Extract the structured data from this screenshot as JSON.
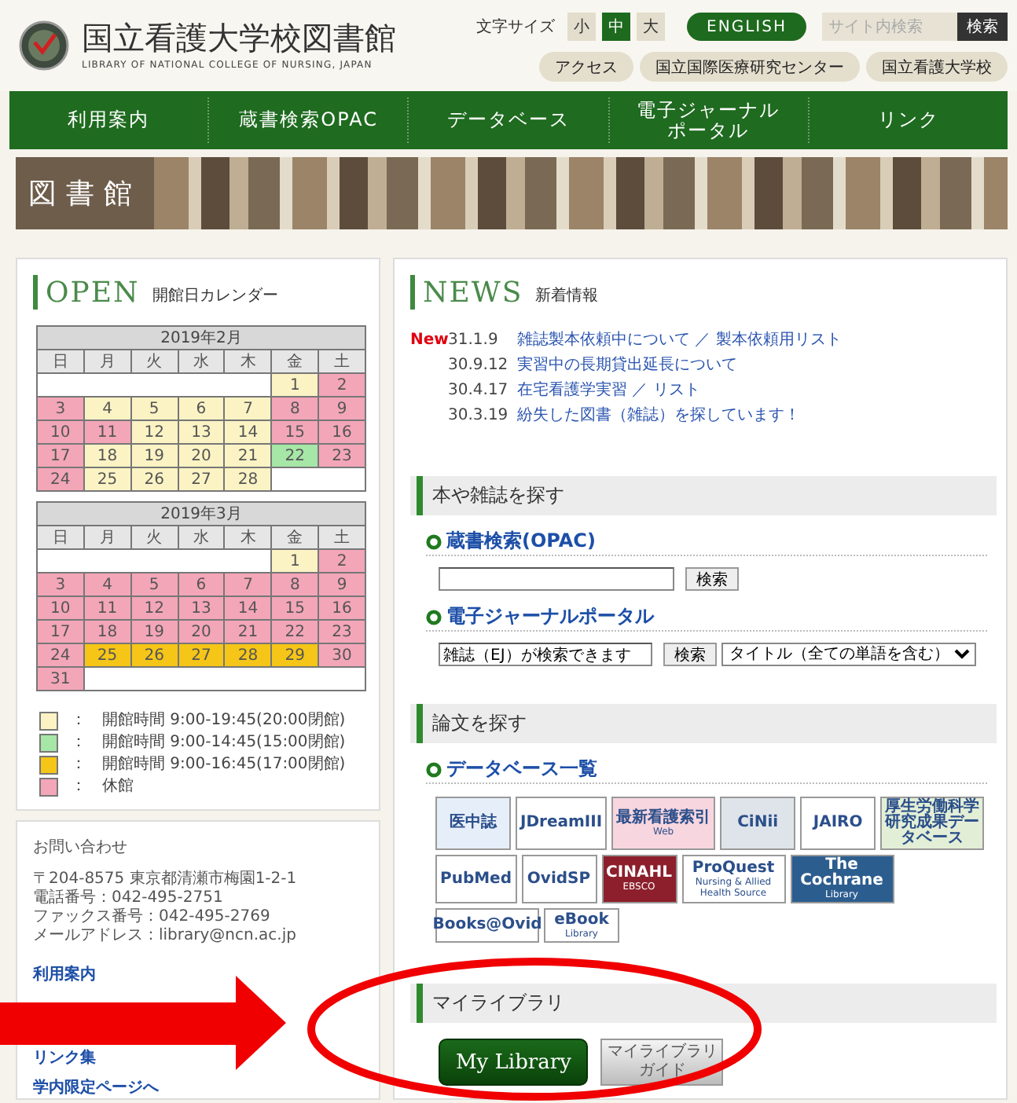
{
  "header": {
    "title": "国立看護大学校図書館",
    "subtitle": "LIBRARY OF NATIONAL COLLEGE OF NURSING, JAPAN",
    "font_size_label": "文字サイズ",
    "font_sizes": [
      {
        "label": "小",
        "selected": false
      },
      {
        "label": "中",
        "selected": true
      },
      {
        "label": "大",
        "selected": false
      }
    ],
    "english_button": "ENGLISH",
    "search": {
      "placeholder": "サイト内検索",
      "button": "検索"
    },
    "links": [
      "アクセス",
      "国立国際医療研究センター",
      "国立看護大学校"
    ]
  },
  "nav": [
    "利用案内",
    "蔵書検索OPAC",
    "データベース",
    "電子ジャーナルポータル",
    "リンク"
  ],
  "banner": {
    "label": "図書館"
  },
  "calendar_card": {
    "title": "OPEN",
    "subtitle": "開館日カレンダー",
    "months": [
      {
        "title": "2019年2月",
        "weekdays": [
          "日",
          "月",
          "火",
          "水",
          "木",
          "金",
          "土"
        ],
        "weeks": [
          [
            {
              "day": "1",
              "color": "#fbf3c4"
            },
            {
              "day": "2",
              "color": "#f3a6b8"
            }
          ],
          [
            {
              "day": "3",
              "color": "#f3a6b8"
            },
            {
              "day": "4",
              "color": "#fbf3c4"
            },
            {
              "day": "5",
              "color": "#fbf3c4"
            },
            {
              "day": "6",
              "color": "#fbf3c4"
            },
            {
              "day": "7",
              "color": "#fbf3c4"
            },
            {
              "day": "8",
              "color": "#f3a6b8"
            },
            {
              "day": "9",
              "color": "#f3a6b8"
            }
          ],
          [
            {
              "day": "10",
              "color": "#f3a6b8"
            },
            {
              "day": "11",
              "color": "#f3a6b8"
            },
            {
              "day": "12",
              "color": "#fbf3c4"
            },
            {
              "day": "13",
              "color": "#fbf3c4"
            },
            {
              "day": "14",
              "color": "#fbf3c4"
            },
            {
              "day": "15",
              "color": "#f3a6b8"
            },
            {
              "day": "16",
              "color": "#f3a6b8"
            }
          ],
          [
            {
              "day": "17",
              "color": "#f3a6b8"
            },
            {
              "day": "18",
              "color": "#fbf3c4"
            },
            {
              "day": "19",
              "color": "#fbf3c4"
            },
            {
              "day": "20",
              "color": "#fbf3c4"
            },
            {
              "day": "21",
              "color": "#fbf3c4"
            },
            {
              "day": "22",
              "color": "#a6e6a6"
            },
            {
              "day": "23",
              "color": "#f3a6b8"
            }
          ],
          [
            {
              "day": "24",
              "color": "#f3a6b8"
            },
            {
              "day": "25",
              "color": "#fbf3c4"
            },
            {
              "day": "26",
              "color": "#fbf3c4"
            },
            {
              "day": "27",
              "color": "#fbf3c4"
            },
            {
              "day": "28",
              "color": "#fbf3c4"
            }
          ]
        ]
      },
      {
        "title": "2019年3月",
        "weekdays": [
          "日",
          "月",
          "火",
          "水",
          "木",
          "金",
          "土"
        ],
        "weeks": [
          [
            {
              "day": "1",
              "color": "#fbf3c4"
            },
            {
              "day": "2",
              "color": "#f3a6b8"
            }
          ],
          [
            {
              "day": "3",
              "color": "#f3a6b8"
            },
            {
              "day": "4",
              "color": "#f3a6b8"
            },
            {
              "day": "5",
              "color": "#f3a6b8"
            },
            {
              "day": "6",
              "color": "#f3a6b8"
            },
            {
              "day": "7",
              "color": "#f3a6b8"
            },
            {
              "day": "8",
              "color": "#f3a6b8"
            },
            {
              "day": "9",
              "color": "#f3a6b8"
            }
          ],
          [
            {
              "day": "10",
              "color": "#f3a6b8"
            },
            {
              "day": "11",
              "color": "#f3a6b8"
            },
            {
              "day": "12",
              "color": "#f3a6b8"
            },
            {
              "day": "13",
              "color": "#f3a6b8"
            },
            {
              "day": "14",
              "color": "#f3a6b8"
            },
            {
              "day": "15",
              "color": "#f3a6b8"
            },
            {
              "day": "16",
              "color": "#f3a6b8"
            }
          ],
          [
            {
              "day": "17",
              "color": "#f3a6b8"
            },
            {
              "day": "18",
              "color": "#f3a6b8"
            },
            {
              "day": "19",
              "color": "#f3a6b8"
            },
            {
              "day": "20",
              "color": "#f3a6b8"
            },
            {
              "day": "21",
              "color": "#f3a6b8"
            },
            {
              "day": "22",
              "color": "#f3a6b8"
            },
            {
              "day": "23",
              "color": "#f3a6b8"
            }
          ],
          [
            {
              "day": "24",
              "color": "#f3a6b8"
            },
            {
              "day": "25",
              "color": "#f5c518"
            },
            {
              "day": "26",
              "color": "#f5c518"
            },
            {
              "day": "27",
              "color": "#f5c518"
            },
            {
              "day": "28",
              "color": "#f5c518"
            },
            {
              "day": "29",
              "color": "#f5c518"
            },
            {
              "day": "30",
              "color": "#f3a6b8"
            }
          ],
          [
            {
              "day": "31",
              "color": "#f3a6b8"
            }
          ]
        ]
      }
    ],
    "legend": [
      {
        "color": "#fbf3c4",
        "colon": "：",
        "text": "開館時間 9:00-19:45(20:00閉館)"
      },
      {
        "color": "#a6e6a6",
        "colon": "：",
        "text": "開館時間 9:00-14:45(15:00閉館)"
      },
      {
        "color": "#f5c518",
        "colon": "：",
        "text": "開館時間 9:00-16:45(17:00閉館)"
      },
      {
        "color": "#f3a6b8",
        "colon": "：",
        "text": "休館"
      }
    ]
  },
  "contact": {
    "title": "お問い合わせ",
    "lines": [
      "〒204-8575 東京都清瀬市梅園1-2-1",
      "電話番号：042-495-2751",
      "ファックス番号：042-495-2769",
      "メールアドレス：library@ncn.ac.jp"
    ],
    "links": [
      "利用案内",
      "リンク集",
      "学内限定ページへ"
    ]
  },
  "news": {
    "title": "NEWS",
    "subtitle": "新着情報",
    "new_label": "New",
    "items": [
      {
        "new": true,
        "date": "31.1.9",
        "title": "雑誌製本依頼中について ／ 製本依頼用リスト"
      },
      {
        "new": false,
        "date": "30.9.12",
        "title": "実習中の長期貸出延長について"
      },
      {
        "new": false,
        "date": "30.4.17",
        "title": "在宅看護学実習 ／ リスト"
      },
      {
        "new": false,
        "date": "30.3.19",
        "title": "紛失した図書（雑誌）を探しています！"
      }
    ]
  },
  "book_search": {
    "title": "本や雑誌を探す",
    "opac": {
      "title": "蔵書検索(OPAC)",
      "button": "検索"
    },
    "ejournal": {
      "title": "電子ジャーナルポータル",
      "value": "雑誌（EJ）が検索できます",
      "button": "検索",
      "select": "タイトル（全ての単語を含む）"
    }
  },
  "paper_search": {
    "title": "論文を探す",
    "subtitle": "データベース一覧",
    "rows": [
      [
        {
          "lines": [
            "医中誌"
          ],
          "color": "#e6eef9"
        },
        {
          "lines": [
            "JDreamIII"
          ],
          "color": "#ffffff"
        },
        {
          "lines": [
            "最新看護索引",
            "Web"
          ],
          "color": "#f8d6df"
        },
        {
          "lines": [
            "CiNii"
          ],
          "color": "#dfe4ea"
        },
        {
          "lines": [
            "JAIRO"
          ],
          "color": "#ffffff"
        },
        {
          "lines": [
            "厚生労働科学研究成果データベース"
          ],
          "color": "#e3eed6"
        }
      ],
      [
        {
          "lines": [
            "PubMed"
          ],
          "color": "#ffffff"
        },
        {
          "lines": [
            "OvidSP"
          ],
          "color": "#ffffff"
        },
        {
          "lines": [
            "CINAHL",
            "EBSCO"
          ],
          "color": "#8c1f2b"
        },
        {
          "lines": [
            "ProQuest",
            "Nursing & Allied Health Source"
          ],
          "color": "#ffffff"
        },
        {
          "lines": [
            "The Cochrane",
            "Library"
          ],
          "color": "#2c5d8f"
        }
      ],
      [
        {
          "lines": [
            "Books@Ovid"
          ],
          "color": "#ffffff"
        },
        {
          "lines": [
            "eBook",
            "Library"
          ],
          "color": "#ffffff"
        }
      ]
    ]
  },
  "my_library": {
    "title": "マイライブラリ",
    "button": "My Library",
    "guide": "マイライブラリガイド"
  }
}
